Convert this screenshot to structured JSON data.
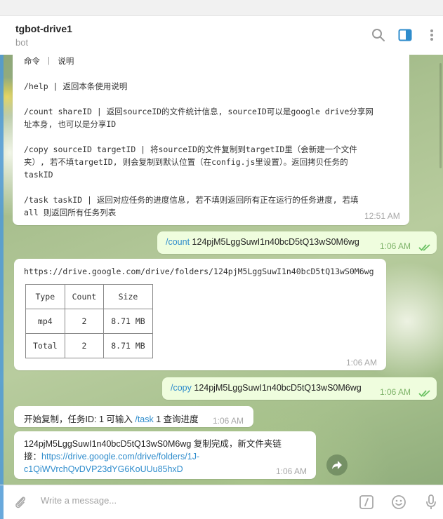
{
  "header": {
    "title": "tgbot-drive1",
    "subtitle": "bot"
  },
  "messages": {
    "help": {
      "lines": [
        "命令 ｜ 说明",
        "",
        "/help | 返回本条使用说明",
        "",
        "/count shareID | 返回sourceID的文件统计信息, sourceID可以是google drive分享网",
        "址本身, 也可以是分享ID",
        "",
        "/copy sourceID targetID | 将sourceID的文件复制到targetID里（会新建一个文件",
        "夹）, 若不填targetID, 则会复制到默认位置（在config.js里设置）。返回拷贝任务的",
        "taskID",
        "",
        "/task taskID | 返回对应任务的进度信息, 若不填则返回所有正在运行的任务进度, 若填",
        "all 则返回所有任务列表"
      ],
      "time": "12:51 AM"
    },
    "count_cmd": {
      "command": "/count",
      "argument": " 124pjM5LggSuwI1n40bcD5tQ13wS0M6wg",
      "time": "1:06 AM"
    },
    "count_result": {
      "url": "https://drive.google.com/drive/folders/124pjM5LggSuwI1n40bcD5tQ13wS0M6wg",
      "table": {
        "headers": [
          "Type",
          "Count",
          "Size"
        ],
        "rows": [
          [
            "mp4",
            "2",
            "8.71 MB"
          ],
          [
            "Total",
            "2",
            "8.71 MB"
          ]
        ]
      },
      "time": "1:06 AM"
    },
    "copy_cmd": {
      "command": "/copy",
      "argument": " 124pjM5LggSuwI1n40bcD5tQ13wS0M6wg",
      "time": "1:06 AM"
    },
    "copy_start": {
      "prefix": "开始复制，任务ID: 1 可输入 ",
      "command": "/task",
      "suffix": " 1 查询进度",
      "time": "1:06 AM"
    },
    "copy_done": {
      "line1": "124pjM5LggSuwI1n40bcD5tQ13wS0M6wg 复制完成，新文件夹链",
      "line2_prefix": "接：",
      "link_part1": "https://drive.google.com/drive/folders/1J-",
      "link_part2": "c1QiWVrchQvDVP23dYG6KoUUu85hxD",
      "time": "1:06 AM"
    }
  },
  "composer": {
    "placeholder": "Write a message..."
  },
  "icons": {
    "search": "search-icon",
    "sidebar_toggle": "sidebar-toggle-icon",
    "more": "more-vertical-icon",
    "attach": "paperclip-icon",
    "commands": "slash-command-icon",
    "emoji": "emoji-icon",
    "mic": "microphone-icon",
    "forward": "forward-icon",
    "read": "double-check-icon"
  },
  "colors": {
    "accent": "#2e8ccc",
    "outgoing_bubble": "#effdde",
    "read_check": "#6cc264"
  }
}
